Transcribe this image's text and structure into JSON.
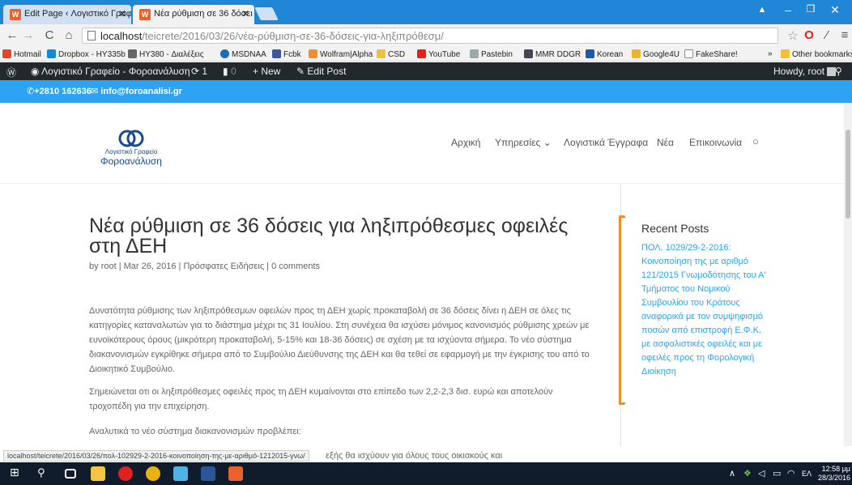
{
  "browser": {
    "tabs": [
      {
        "title": "Edit Page ‹ Λογιστικό Γραφ"
      },
      {
        "title": "Νέα ρύθμιση σε 36 δόσει"
      }
    ],
    "url_host": "localhost",
    "url_path": "/teicrete/2016/03/26/νέα-ρύθμιση-σε-36-δόσεις-για-ληξιπρόθεσμ/",
    "bookmarks": [
      "Hotmail",
      "Dropbox - HY335b",
      "HY380 - Διαλέξεις",
      "MSDNAA",
      "Fcbk",
      "Wolfram|Alpha",
      "CSD",
      "YouTube",
      "Pastebin",
      "MMR DDGR",
      "Korean",
      "Google4U",
      "FakeShare!"
    ],
    "bookmarks_more": "»",
    "other_bookmarks": "Other bookmarks",
    "status_url": "localhost/teicrete/2016/03/26/πολ-102929-2-2016-κοινοποίηση-της-με-αριθμό-1212015-γνω/"
  },
  "adminbar": {
    "site_name": "Λογιστικό Γραφείο - Φοροανάλυση",
    "updates": "1",
    "comments": "0",
    "new_label": "New",
    "edit_label": "Edit Post",
    "howdy": "Howdy, root"
  },
  "topbar": {
    "phone": "+2810 162636",
    "email": "info@foroanalisi.gr"
  },
  "header": {
    "logo_line1": "Λογιστικό Γραφείο",
    "logo_line2": "Φοροανάλυση",
    "menu": [
      "Αρχική",
      "Υπηρεσίες",
      "Λογιστικά Έγγραφα",
      "Νέα",
      "Επικοινωνία"
    ]
  },
  "post": {
    "title": "Νέα ρύθμιση σε 36 δόσεις για ληξιπρόθεσμες οφειλές στη ΔΕΗ",
    "meta_by": "by",
    "author": "root",
    "date": "Mar 26, 2016",
    "category": "Πρόσφατες Ειδήσεις",
    "comments": "0 comments",
    "p1": "Δυνατότητα ρύθμισης των ληξιπρόθεσμων οφειλών προς τη ΔΕΗ χωρίς προκαταβολή σε 36 δόσεις δίνει η ΔΕΗ σε όλες τις κατηγορίες καταναλωτών για το διάστημα μέχρι τις 31 Ιουλίου. Στη συνέχεια θα ισχύσει μόνιμος κανονισμός ρύθμισης χρεών με ευνοϊκότερους όρους (μικρότερη προκαταβολή, 5-15% και 18-36 δόσεις) σε σχέση με τα ισχύοντα σήμερα. Το νέο σύστημα διακανονισμών εγκρίθηκε σήμερα από το Συμβούλιο Διεύθυνσης της ΔΕΗ και θα τεθεί σε εφαρμογή με την έγκρισης του από το Διοικητικό Συμβούλιο.",
    "p2": "Σημειώνεται οτι οι ληξιπρόθεσμες οφειλές προς τη ΔΕΗ κυμαίνονται στο επίπεδο των 2,2-2,3 δισ. ευρώ και αποτελούν τροχοπέδη για την επιχείρηση.",
    "p3": "Αναλυτικά το νέο σύστημα διακανονισμών προβλέπει:",
    "p4_partial": "εξής θα ισχύουν για όλους τους οικιακούς και"
  },
  "sidebar": {
    "recent_title": "Recent Posts",
    "recent_post": "ΠΟΛ. 1029/29-2-2016: Κοινοποίηση της με αριθμό 121/2015 Γνωμοδότησης του Α' Τμήματος του Νομικού Συμβουλίου του Κράτους αναφορικά με τον συμψηφισμό ποσών από επιστροφή Ε.Φ.Κ. με ασφαλιστικές οφειλές και με οφειλές προς τη Φορολογική Διοίκηση"
  },
  "taskbar": {
    "time": "12:58 μμ",
    "date": "28/3/2016",
    "lang": "ΕΛ"
  },
  "colors": {
    "accent": "#2ea3f2",
    "adminbar": "#23282d",
    "annotation": "#f08a2c"
  }
}
